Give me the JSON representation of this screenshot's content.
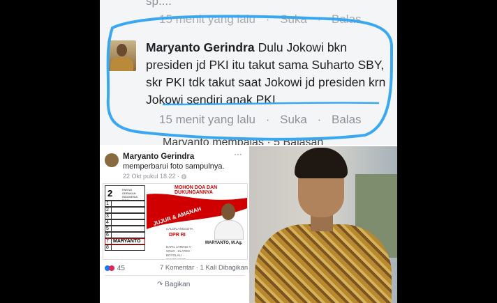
{
  "comment_section": {
    "previous_comment_cut": "sp....",
    "previous_meta": {
      "time": "15 menit yang lalu",
      "like": "Suka",
      "reply": "Balas"
    },
    "author": "Maryanto Gerindra",
    "text": "Dulu Jokowi bkn presiden jd PKI itu takut sama Suharto SBY, skr PKI tdk takut saat Jokowi jd presiden krn Jokowi sendiri anak PKI",
    "meta": {
      "time": "15 menit yang lalu",
      "like": "Suka",
      "reply": "Balas"
    },
    "next_reply_cut": "Maryanto membalas · 5 Balasan",
    "highlight_color": "#3aa8f0"
  },
  "post": {
    "author": "Maryanto Gerindra",
    "action": "memperbarui foto sampulnya.",
    "date": "22 Okt pukul 18.22 · ",
    "more": "···",
    "banner": {
      "ballot_number": "2",
      "party": "PARTAI GERAKAN INDONESIA RAYA",
      "rows": [
        "1",
        "2",
        "3",
        "4",
        "5",
        "6",
        "7",
        "8"
      ],
      "marked_row_name": "MARYANTO",
      "headline": "MOHON DOA DAN DUKUNGANNYA",
      "slogan": "JUJUR & AMANAH",
      "calon": "CALON ANGGOTA",
      "dpr": "DPR RI",
      "dapil": "DAPIL JATENG V · SOLO · KLATEN · BOYOLALI · SUKOHARJO",
      "candidate_name": "MARYANTO, M.Ag."
    },
    "reaction_count": "45",
    "stats": "7 Komentar · 1 Kali Dibagikan",
    "share_label": "Bagikan"
  },
  "colors": {
    "accent_red": "#d10000",
    "fb_blue": "#1877f2"
  }
}
